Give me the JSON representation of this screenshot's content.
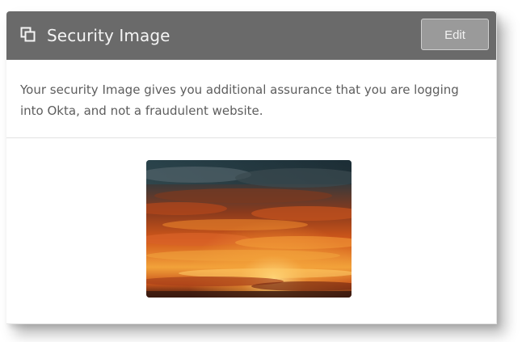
{
  "security_panel": {
    "title": "Security Image",
    "edit_label": "Edit",
    "description": "Your security Image gives you additional assurance that you are logging into Okta, and not a fraudulent website.",
    "image_subject": "sunset-clouds"
  },
  "colors": {
    "header_bg": "#6a6a6a",
    "edit_button_bg": "#9a9a9a",
    "body_text": "#5d5d5d"
  }
}
